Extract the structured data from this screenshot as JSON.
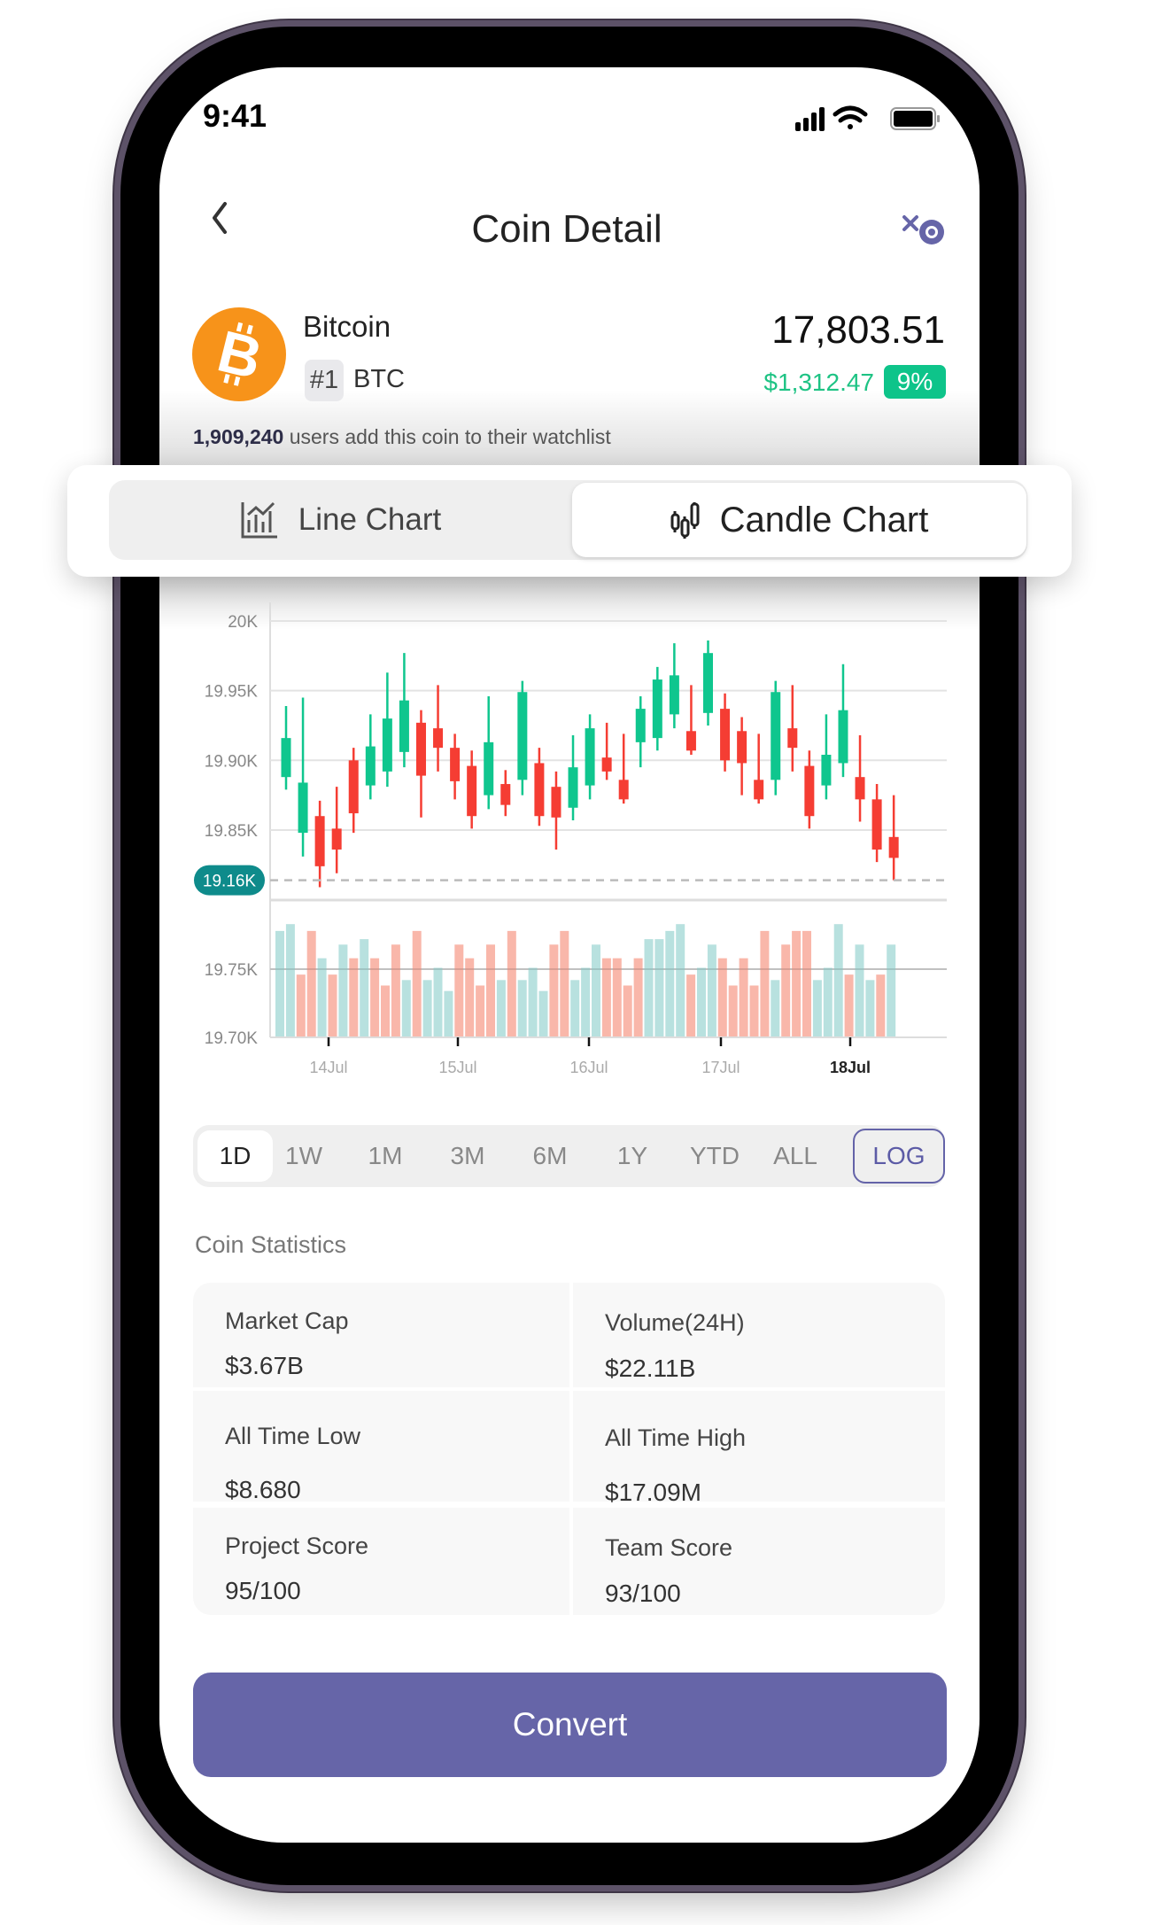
{
  "status_bar": {
    "time": "9:41",
    "icons": [
      "signal-icon",
      "wifi-icon",
      "battery-icon"
    ]
  },
  "header": {
    "title": "Coin Detail",
    "back_icon": "chevron-left-icon",
    "watch_icon": "eye-slash-icon"
  },
  "coin": {
    "name": "Bitcoin",
    "rank": "#1",
    "symbol": "BTC",
    "price": "17,803.51",
    "change": "$1,312.47",
    "change_pct": "9%",
    "watchlist_count": "1,909,240",
    "watchlist_text": " users add this coin to their watchlist"
  },
  "chart_tabs": [
    {
      "label": "Line Chart",
      "icon": "line-chart-icon",
      "active": false
    },
    {
      "label": "Candle Chart",
      "icon": "candle-chart-icon",
      "active": true
    }
  ],
  "colors": {
    "up": "#0fc68e",
    "down": "#f53d33",
    "volume_up": "#b4dfdd",
    "volume_down": "#f9b3a5",
    "accent": "#6665a8",
    "price_marker": "#0e8b8b"
  },
  "chart_data": {
    "type": "candlestick",
    "y_ticks": [
      "20K",
      "19.95K",
      "19.90K",
      "19.85K"
    ],
    "y_tick_values": [
      20000,
      19950,
      19900,
      19850
    ],
    "volume_ticks": [
      "19.75K",
      "19.70K"
    ],
    "volume_tick_values": [
      19750,
      19700
    ],
    "ylim": [
      19814,
      20000
    ],
    "current_price_label": "19.16K",
    "current_price_value": 19814,
    "x_labels": [
      "14Jul",
      "15Jul",
      "16Jul",
      "17Jul",
      "18Jul"
    ],
    "x_selected": "18Jul",
    "grid": true,
    "ohlc": [
      [
        19888,
        19939,
        19879,
        19916
      ],
      [
        19848,
        19945,
        19831,
        19884
      ],
      [
        19860,
        19871,
        19809,
        19824
      ],
      [
        19851,
        19881,
        19819,
        19836
      ],
      [
        19900,
        19909,
        19848,
        19862
      ],
      [
        19882,
        19933,
        19872,
        19910
      ],
      [
        19892,
        19963,
        19881,
        19930
      ],
      [
        19906,
        19977,
        19895,
        19943
      ],
      [
        19927,
        19936,
        19859,
        19889
      ],
      [
        19923,
        19954,
        19892,
        19909
      ],
      [
        19909,
        19919,
        19872,
        19885
      ],
      [
        19896,
        19907,
        19851,
        19860
      ],
      [
        19875,
        19946,
        19865,
        19913
      ],
      [
        19883,
        19893,
        19860,
        19868
      ],
      [
        19886,
        19957,
        19875,
        19949
      ],
      [
        19898,
        19909,
        19853,
        19860
      ],
      [
        19881,
        19892,
        19836,
        19859
      ],
      [
        19866,
        19918,
        19857,
        19895
      ],
      [
        19882,
        19933,
        19872,
        19923
      ],
      [
        19902,
        19927,
        19886,
        19892
      ],
      [
        19886,
        19919,
        19869,
        19872
      ],
      [
        19913,
        19946,
        19895,
        19937
      ],
      [
        19916,
        19967,
        19907,
        19958
      ],
      [
        19933,
        19984,
        19923,
        19961
      ],
      [
        19921,
        19954,
        19904,
        19907
      ],
      [
        19934,
        19986,
        19925,
        19977
      ],
      [
        19937,
        19948,
        19892,
        19900
      ],
      [
        19921,
        19931,
        19875,
        19898
      ],
      [
        19886,
        19919,
        19869,
        19872
      ],
      [
        19886,
        19957,
        19875,
        19949
      ],
      [
        19923,
        19954,
        19892,
        19909
      ],
      [
        19896,
        19907,
        19851,
        19860
      ],
      [
        19882,
        19933,
        19872,
        19904
      ],
      [
        19898,
        19969,
        19888,
        19936
      ],
      [
        19888,
        19918,
        19856,
        19872
      ],
      [
        19872,
        19883,
        19827,
        19836
      ],
      [
        19845,
        19875,
        19814,
        19830
      ]
    ],
    "volume_values": [
      19778,
      19783,
      19746,
      19778,
      19758,
      19746,
      19768,
      19758,
      19772,
      19758,
      19738,
      19768,
      19742,
      19778,
      19742,
      19751,
      19734,
      19768,
      19758,
      19738,
      19768,
      19742,
      19778,
      19742,
      19751,
      19734,
      19768,
      19778,
      19742,
      19751,
      19768,
      19758,
      19758,
      19738,
      19758,
      19772,
      19772,
      19778,
      19783,
      19746,
      19751,
      19768,
      19758,
      19738,
      19758,
      19738,
      19778,
      19742,
      19768,
      19778,
      19778,
      19742,
      19751,
      19783,
      19746,
      19768,
      19742,
      19746,
      19768
    ],
    "volume_up": [
      1,
      1,
      0,
      0,
      1,
      0,
      1,
      0,
      1,
      0,
      0,
      0,
      1,
      0,
      1,
      1,
      1,
      0,
      0,
      0,
      0,
      1,
      0,
      1,
      1,
      1,
      0,
      0,
      1,
      1,
      1,
      0,
      0,
      0,
      0,
      1,
      1,
      1,
      1,
      0,
      1,
      1,
      0,
      0,
      0,
      0,
      0,
      1,
      0,
      0,
      0,
      1,
      1,
      1,
      0,
      1,
      1,
      0,
      1
    ]
  },
  "timeframes": [
    {
      "label": "1D",
      "active": true
    },
    {
      "label": "1W"
    },
    {
      "label": "1M"
    },
    {
      "label": "3M"
    },
    {
      "label": "6M"
    },
    {
      "label": "1Y"
    },
    {
      "label": "YTD"
    },
    {
      "label": "ALL"
    },
    {
      "label": "LOG",
      "outlined": true
    }
  ],
  "statistics": {
    "heading": "Coin Statistics",
    "items": [
      {
        "label": "Market Cap",
        "value": "$3.67B"
      },
      {
        "label": "Volume(24H)",
        "value": "$22.11B"
      },
      {
        "label": "All Time Low",
        "value": "$8.680"
      },
      {
        "label": "All Time High",
        "value": "$17.09M"
      },
      {
        "label": "Project Score",
        "value": "95/100"
      },
      {
        "label": "Team Score",
        "value": "93/100"
      }
    ]
  },
  "convert_button": "Convert"
}
